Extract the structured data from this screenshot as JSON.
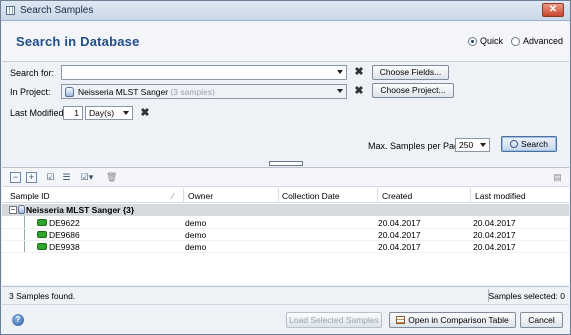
{
  "window": {
    "title": "Search Samples",
    "close_glyph": "✕"
  },
  "header": {
    "title": "Search in Database",
    "mode_options": [
      {
        "label": "Quick",
        "selected": true
      },
      {
        "label": "Advanced",
        "selected": false
      }
    ]
  },
  "form": {
    "search_for": {
      "label": "Search for:",
      "value": "",
      "clear_glyph": "✖",
      "fields_button": "Choose Fields..."
    },
    "project": {
      "label": "In Project:",
      "value": "Neisseria MLST Sanger",
      "count": "(3 samples)",
      "clear_glyph": "✖",
      "button": "Choose Project..."
    },
    "last_modified": {
      "label": "Last Modified:",
      "amount": "1",
      "unit": "Day(s)",
      "clear_glyph": "✖"
    },
    "max_samples": {
      "label": "Max. Samples per Page:",
      "value": "250"
    },
    "search_button": "Search"
  },
  "toolbar": {
    "icons": [
      "collapse-all-icon",
      "expand-all-icon",
      "check-list-icon",
      "uncheck-list-icon",
      "select-menu-icon",
      "delete-icon",
      "clipboard-icon"
    ],
    "glyphs": {
      "collapse": "−",
      "expand": "+",
      "check": "☑",
      "uncheck": "☰",
      "select_menu": "☑▾",
      "delete": "🗑",
      "clipboard": "▤"
    }
  },
  "table": {
    "columns": [
      "Sample ID",
      "Owner",
      "Collection Date",
      "Created",
      "Last modified"
    ],
    "sort_glyph": "⁄",
    "group": {
      "label": "Neisseria MLST Sanger {3}",
      "toggle": "−"
    },
    "rows": [
      {
        "id": "DE9622",
        "owner": "demo",
        "collection_date": "",
        "created": "20.04.2017",
        "last_modified": "20.04.2017"
      },
      {
        "id": "DE9686",
        "owner": "demo",
        "collection_date": "",
        "created": "20.04.2017",
        "last_modified": "20.04.2017"
      },
      {
        "id": "DE9938",
        "owner": "demo",
        "collection_date": "",
        "created": "20.04.2017",
        "last_modified": "20.04.2017"
      }
    ]
  },
  "status": {
    "found": "3 Samples found.",
    "selected": "Samples selected: 0"
  },
  "footer": {
    "help_glyph": "?",
    "load_button": "Load Selected Samples",
    "comparison_button": "Open in Comparison Table",
    "cancel_button": "Cancel"
  }
}
